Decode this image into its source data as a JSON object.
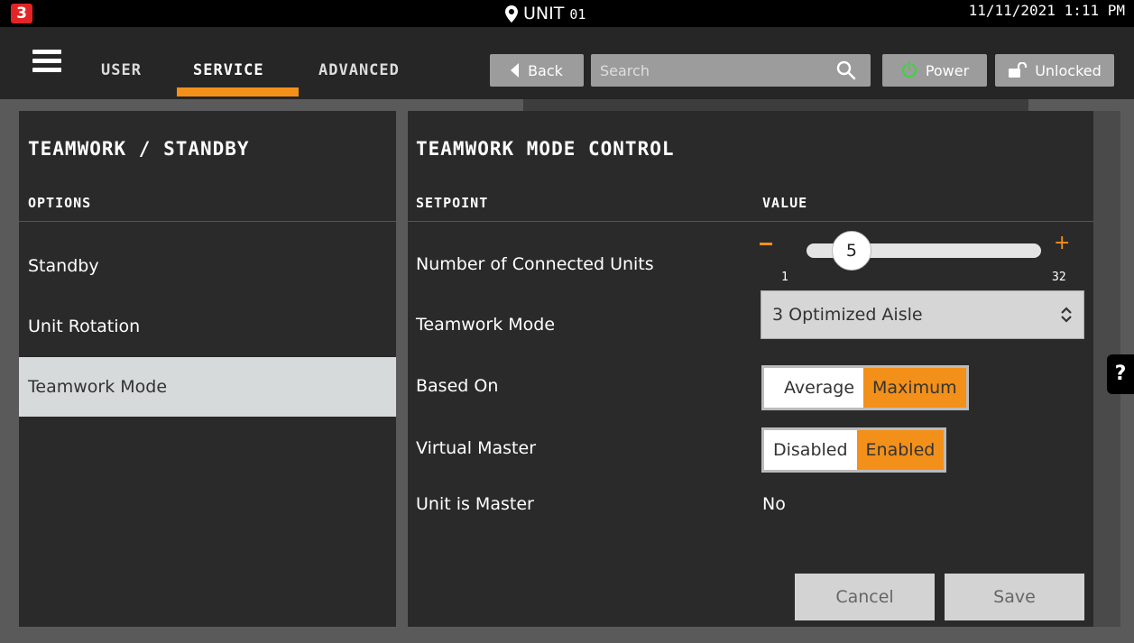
{
  "app": {
    "logo_text": "3"
  },
  "status": {
    "unit_label": "UNIT",
    "unit_number": "01",
    "datetime": "11/11/2021 1:11 PM"
  },
  "nav": {
    "tabs": [
      {
        "label": "USER"
      },
      {
        "label": "SERVICE",
        "active": true
      },
      {
        "label": "ADVANCED"
      }
    ],
    "back_label": "Back",
    "search_placeholder": "Search",
    "search_value": "",
    "power_label": "Power",
    "lock_label": "Unlocked"
  },
  "left": {
    "title": "TEAMWORK / STANDBY",
    "header": "OPTIONS",
    "items": [
      {
        "label": "Standby"
      },
      {
        "label": "Unit Rotation"
      },
      {
        "label": "Teamwork Mode",
        "selected": true
      }
    ]
  },
  "right": {
    "title": "TEAMWORK MODE CONTROL",
    "col_setpoint": "SETPOINT",
    "col_value": "VALUE",
    "connected_units": {
      "label": "Number of Connected Units",
      "value": 5,
      "min": 1,
      "max": 32
    },
    "teamwork_mode": {
      "label": "Teamwork Mode",
      "value": "3 Optimized Aisle"
    },
    "based_on": {
      "label": "Based On",
      "options": [
        "Average",
        "Maximum"
      ],
      "selected": "Maximum"
    },
    "virtual_master": {
      "label": "Virtual Master",
      "options": [
        "Disabled",
        "Enabled"
      ],
      "selected": "Enabled"
    },
    "unit_is_master": {
      "label": "Unit is Master",
      "value": "No"
    },
    "cancel_label": "Cancel",
    "save_label": "Save"
  },
  "help_label": "?",
  "colors": {
    "accent": "#f39019",
    "logo_red": "#e32424",
    "panel": "#2a2a2a",
    "selected_row": "#d6dadb"
  }
}
